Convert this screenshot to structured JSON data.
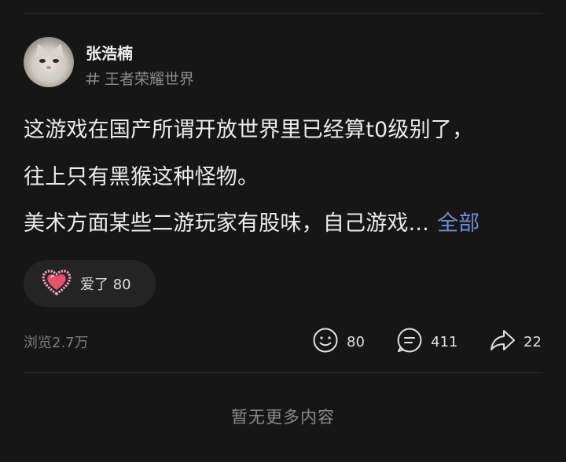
{
  "post": {
    "author": {
      "name": "张浩楠"
    },
    "topic": {
      "label": "王者荣耀世界",
      "icon": "hashtag-icon"
    },
    "content_lines": [
      "这游戏在国产所谓开放世界里已经算t0级别了，",
      "往上只有黑猴这种怪物。",
      "美术方面某些二游玩家有股味，自己游戏..."
    ],
    "expand_label": "全部",
    "reaction": {
      "label": "爱了",
      "count": "80",
      "icon": "heart-frame-icon"
    },
    "views": "浏览2.7万",
    "stats": {
      "likes": {
        "count": "80",
        "icon": "smile-icon"
      },
      "comments": {
        "count": "411",
        "icon": "comment-icon"
      },
      "shares": {
        "count": "22",
        "icon": "share-arrow-icon"
      }
    }
  },
  "footer": {
    "no_more": "暂无更多内容"
  },
  "colors": {
    "background": "#161616",
    "link": "#6f8fcc",
    "muted": "#8a8a8a"
  }
}
